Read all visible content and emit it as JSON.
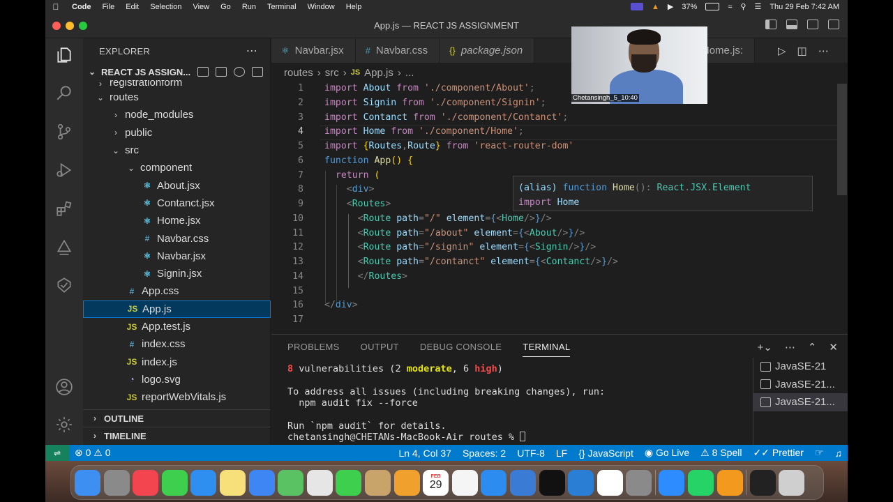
{
  "menubar": {
    "app": "Code",
    "items": [
      "File",
      "Edit",
      "Selection",
      "View",
      "Go",
      "Run",
      "Terminal",
      "Window",
      "Help"
    ],
    "battery": "37%",
    "datetime": "Thu 29 Feb  7:42 AM"
  },
  "window": {
    "title": "App.js — REACT JS ASSIGNMENT"
  },
  "sidebar": {
    "header": "EXPLORER",
    "project": "REACT JS ASSIGN...",
    "tree": [
      {
        "label": "registrationform",
        "indent": 1,
        "type": "folder-closed"
      },
      {
        "label": "routes",
        "indent": 1,
        "type": "folder-open"
      },
      {
        "label": "node_modules",
        "indent": 2,
        "type": "folder-closed"
      },
      {
        "label": "public",
        "indent": 2,
        "type": "folder-closed"
      },
      {
        "label": "src",
        "indent": 2,
        "type": "folder-open"
      },
      {
        "label": "component",
        "indent": 3,
        "type": "folder-open"
      },
      {
        "label": "About.jsx",
        "indent": 4,
        "type": "react"
      },
      {
        "label": "Contanct.jsx",
        "indent": 4,
        "type": "react"
      },
      {
        "label": "Home.jsx",
        "indent": 4,
        "type": "react"
      },
      {
        "label": "Navbar.css",
        "indent": 4,
        "type": "css"
      },
      {
        "label": "Navbar.jsx",
        "indent": 4,
        "type": "react"
      },
      {
        "label": "Signin.jsx",
        "indent": 4,
        "type": "react"
      },
      {
        "label": "App.css",
        "indent": 3,
        "type": "css"
      },
      {
        "label": "App.js",
        "indent": 3,
        "type": "js",
        "selected": true
      },
      {
        "label": "App.test.js",
        "indent": 3,
        "type": "js"
      },
      {
        "label": "index.css",
        "indent": 3,
        "type": "css"
      },
      {
        "label": "index.js",
        "indent": 3,
        "type": "js"
      },
      {
        "label": "logo.svg",
        "indent": 3,
        "type": "svg"
      },
      {
        "label": "reportWebVitals.js",
        "indent": 3,
        "type": "js"
      }
    ],
    "outline": "OUTLINE",
    "timeline": "TIMELINE"
  },
  "tabs": [
    {
      "label": "Navbar.jsx",
      "icon": "react",
      "italic": false
    },
    {
      "label": "Navbar.css",
      "icon": "css",
      "italic": false
    },
    {
      "label": "package.json",
      "icon": "json",
      "italic": true
    },
    {
      "label": "Home.js:",
      "icon": "react",
      "italic": false
    }
  ],
  "breadcrumb": [
    "routes",
    "src",
    "JS",
    "App.js",
    "..."
  ],
  "code": {
    "current_line": 4,
    "lines": [
      [
        [
          "k",
          "import "
        ],
        [
          "v",
          "About"
        ],
        [
          "k",
          " from "
        ],
        [
          "s",
          "'./component/About'"
        ],
        [
          "p",
          ";"
        ]
      ],
      [
        [
          "k",
          "import "
        ],
        [
          "v",
          "Signin"
        ],
        [
          "k",
          " from "
        ],
        [
          "s",
          "'./component/Signin'"
        ],
        [
          "p",
          ";"
        ]
      ],
      [
        [
          "k",
          "import "
        ],
        [
          "v",
          "Contanct"
        ],
        [
          "k",
          " from "
        ],
        [
          "s",
          "'./component/Contanct'"
        ],
        [
          "p",
          ";"
        ]
      ],
      [
        [
          "k",
          "import "
        ],
        [
          "v",
          "Home"
        ],
        [
          "k",
          " from "
        ],
        [
          "s",
          "'./component/Home'"
        ],
        [
          "p",
          ";"
        ]
      ],
      [
        [
          "k",
          "import "
        ],
        [
          "br",
          "{"
        ],
        [
          "v",
          "Routes"
        ],
        [
          "p",
          ","
        ],
        [
          "v",
          "Route"
        ],
        [
          "br",
          "}"
        ],
        [
          "k",
          " from "
        ],
        [
          "s",
          "'react-router-dom'"
        ]
      ],
      [
        [
          "kb",
          "function "
        ],
        [
          "f",
          "App"
        ],
        [
          "br",
          "()"
        ],
        [
          "p",
          " "
        ],
        [
          "br",
          "{"
        ]
      ],
      [
        [
          "p",
          "  "
        ],
        [
          "k",
          "return "
        ],
        [
          "br",
          "("
        ]
      ],
      [
        [
          "p",
          "    "
        ],
        [
          "p",
          "<"
        ],
        [
          "tg",
          "div"
        ],
        [
          "p",
          ">"
        ]
      ],
      [
        [
          "p",
          "    "
        ],
        [
          "p",
          "<"
        ],
        [
          "t",
          "Routes"
        ],
        [
          "p",
          ">"
        ]
      ],
      [
        [
          "p",
          "      "
        ],
        [
          "p",
          "<"
        ],
        [
          "t",
          "Route"
        ],
        [
          "v",
          " path"
        ],
        [
          "p",
          "="
        ],
        [
          "s",
          "\"/\""
        ],
        [
          "v",
          " element"
        ],
        [
          "p",
          "="
        ],
        [
          "kb",
          "{"
        ],
        [
          "p",
          "<"
        ],
        [
          "t",
          "Home"
        ],
        [
          "p",
          "/>"
        ],
        [
          "kb",
          "}"
        ],
        [
          "p",
          "/>"
        ]
      ],
      [
        [
          "p",
          "      "
        ],
        [
          "p",
          "<"
        ],
        [
          "t",
          "Route"
        ],
        [
          "v",
          " path"
        ],
        [
          "p",
          "="
        ],
        [
          "s",
          "\"/about\""
        ],
        [
          "v",
          " element"
        ],
        [
          "p",
          "="
        ],
        [
          "kb",
          "{"
        ],
        [
          "p",
          "<"
        ],
        [
          "t",
          "About"
        ],
        [
          "p",
          "/>"
        ],
        [
          "kb",
          "}"
        ],
        [
          "p",
          "/>"
        ]
      ],
      [
        [
          "p",
          "      "
        ],
        [
          "p",
          "<"
        ],
        [
          "t",
          "Route"
        ],
        [
          "v",
          " path"
        ],
        [
          "p",
          "="
        ],
        [
          "s",
          "\"/signin\""
        ],
        [
          "v",
          " element"
        ],
        [
          "p",
          "="
        ],
        [
          "kb",
          "{"
        ],
        [
          "p",
          "<"
        ],
        [
          "t",
          "Signin"
        ],
        [
          "p",
          "/>"
        ],
        [
          "kb",
          "}"
        ],
        [
          "p",
          "/>"
        ]
      ],
      [
        [
          "p",
          "      "
        ],
        [
          "p",
          "<"
        ],
        [
          "t",
          "Route"
        ],
        [
          "v",
          " path"
        ],
        [
          "p",
          "="
        ],
        [
          "s",
          "\"/contanct\""
        ],
        [
          "v",
          " element"
        ],
        [
          "p",
          "="
        ],
        [
          "kb",
          "{"
        ],
        [
          "p",
          "<"
        ],
        [
          "t",
          "Contanct"
        ],
        [
          "p",
          "/>"
        ],
        [
          "kb",
          "}"
        ],
        [
          "p",
          "/>"
        ]
      ],
      [
        [
          "p",
          "      "
        ],
        [
          "p",
          "</"
        ],
        [
          "t",
          "Routes"
        ],
        [
          "p",
          ">"
        ]
      ],
      [],
      [
        [
          "p",
          "</"
        ],
        [
          "tg",
          "div"
        ],
        [
          "p",
          ">"
        ]
      ],
      []
    ],
    "hover_line1": [
      [
        "v",
        "(alias) "
      ],
      [
        "kb",
        "function "
      ],
      [
        "f",
        "Home"
      ],
      [
        "p",
        "(): "
      ],
      [
        "t",
        "React"
      ],
      [
        "p",
        "."
      ],
      [
        "t",
        "JSX"
      ],
      [
        "p",
        "."
      ],
      [
        "t",
        "Element"
      ]
    ],
    "hover_line2": [
      [
        "k",
        "import "
      ],
      [
        "v",
        "Home"
      ]
    ]
  },
  "webcam": {
    "label": "Chetansingh_5_10:40"
  },
  "panel": {
    "tabs": [
      "PROBLEMS",
      "OUTPUT",
      "DEBUG CONSOLE",
      "TERMINAL"
    ],
    "active_tab": "TERMINAL",
    "terminal": {
      "vuln_count": "8",
      "vuln_text": " vulnerabilities (2 ",
      "moderate": "moderate",
      "mid": ", 6 ",
      "high": "high",
      "close": ")",
      "line2": "To address all issues (including breaking changes), run:",
      "line3": "  npm audit fix --force",
      "line4": "Run `npm audit` for details.",
      "prompt": "chetansingh@CHETANs-MacBook-Air routes % "
    },
    "terminals": [
      {
        "label": "JavaSE-21"
      },
      {
        "label": "JavaSE-21..."
      },
      {
        "label": "JavaSE-21...",
        "selected": true
      }
    ]
  },
  "status": {
    "errors": "0",
    "warnings": "0",
    "position": "Ln 4, Col 37",
    "spaces": "Spaces: 2",
    "encoding": "UTF-8",
    "eol": "LF",
    "language": "JavaScript",
    "golive": "Go Live",
    "spell": "8 Spell",
    "prettier": "Prettier"
  },
  "dock": {
    "calendar_day": "29",
    "calendar_month": "FEB",
    "apps": [
      "finder",
      "launchpad",
      "music",
      "messages",
      "safari",
      "notes",
      "mail",
      "maps",
      "photos",
      "facetime",
      "keynote",
      "sketch",
      "calendar",
      "reminders",
      "appstore",
      "keynote2",
      "tv",
      "vscode",
      "chrome",
      "settings",
      "zoom",
      "whatsapp",
      "vlc",
      "terminal",
      "trash"
    ]
  },
  "colors": {
    "accent": "#007acc",
    "remote": "#16825d",
    "selection": "#04395e"
  }
}
